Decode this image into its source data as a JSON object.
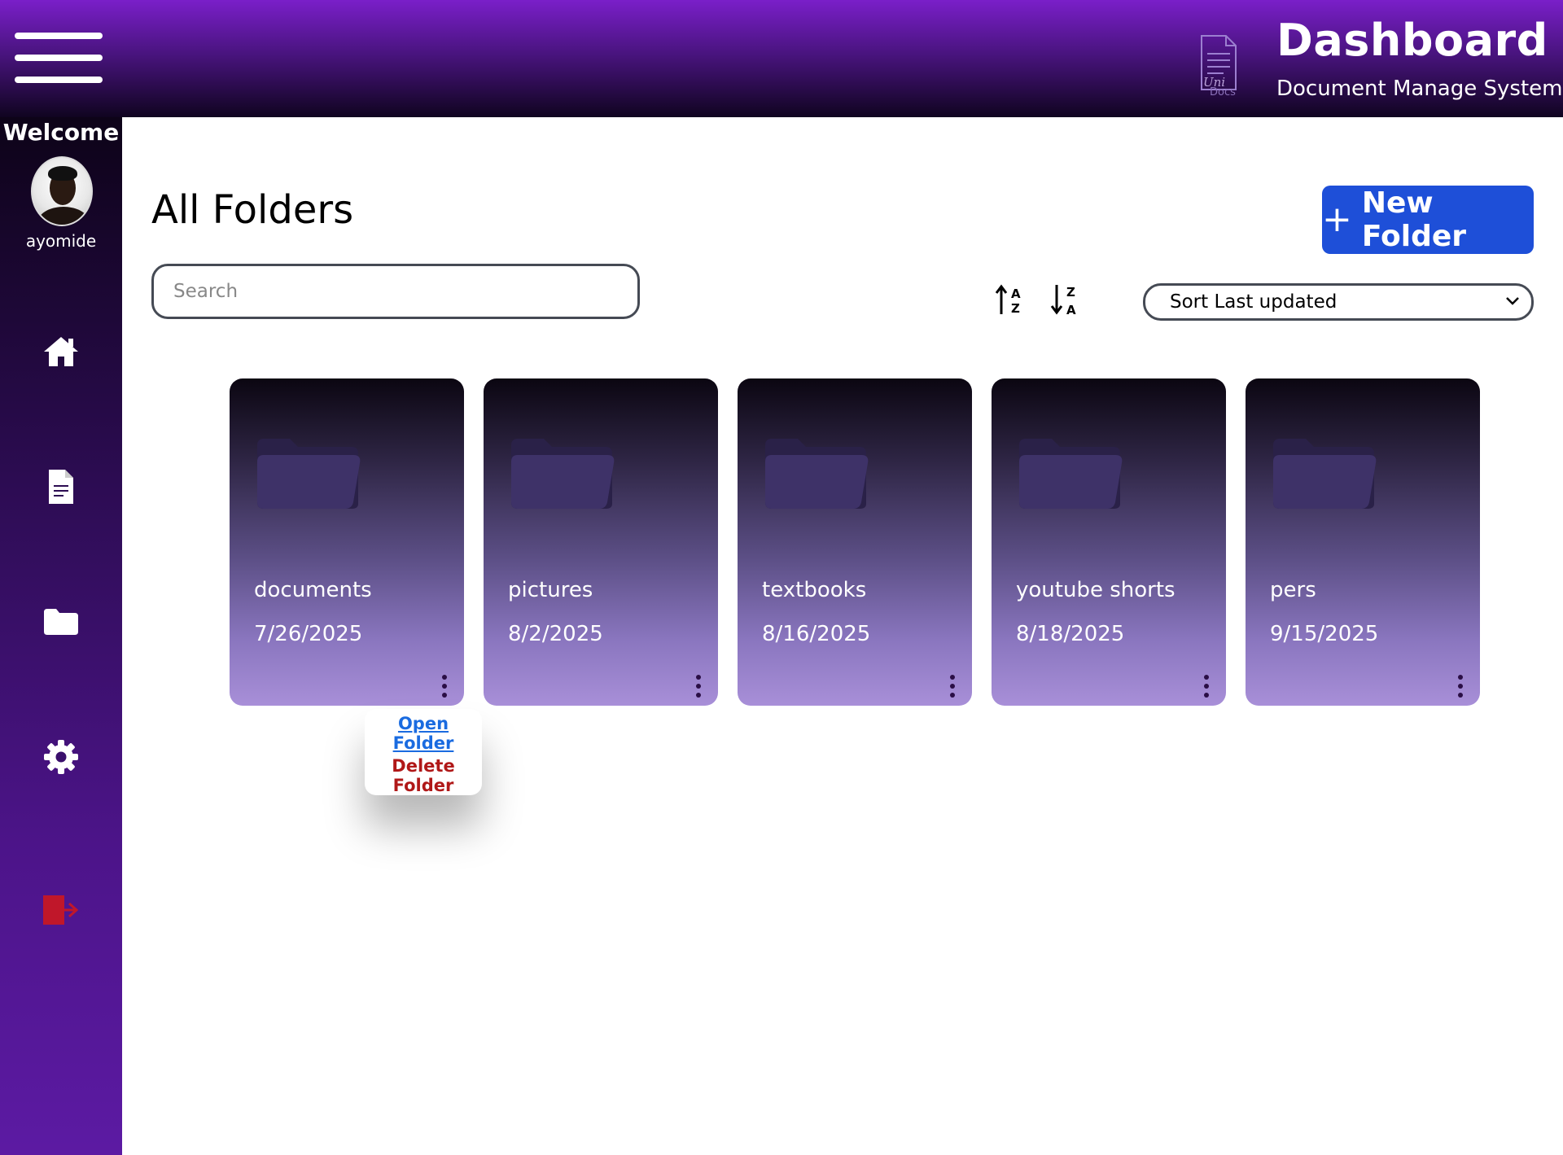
{
  "header": {
    "title": "Dashboard",
    "subtitle": "Document Manage System",
    "logo_line1": "Uni",
    "logo_line2": "Docs",
    "menu_icon": "hamburger-icon"
  },
  "sidebar": {
    "welcome": "Welcome",
    "username": "ayomide",
    "nav": [
      {
        "icon": "home-icon"
      },
      {
        "icon": "document-icon"
      },
      {
        "icon": "folder-icon"
      },
      {
        "icon": "gear-icon"
      },
      {
        "icon": "logout-icon",
        "color": "#c0172a"
      }
    ]
  },
  "main": {
    "title": "All Folders",
    "new_folder_label": "New Folder",
    "search_placeholder": "Search",
    "sort_select": "Sort Last updated",
    "sort_icons": [
      "sort-a-z-icon",
      "sort-z-a-icon"
    ]
  },
  "folders": [
    {
      "name": "documents",
      "date": "7/26/2025"
    },
    {
      "name": "pictures",
      "date": "8/2/2025"
    },
    {
      "name": "textbooks",
      "date": "8/16/2025"
    },
    {
      "name": "youtube shorts",
      "date": "8/18/2025"
    },
    {
      "name": "pers",
      "date": "9/15/2025"
    }
  ],
  "context_menu": {
    "open": "Open Folder",
    "delete": "Delete Folder"
  },
  "colors": {
    "accent": "#1e4fd8",
    "header_top": "#7a1fc9",
    "sidebar_bottom": "#5c1aa3",
    "delete": "#b01818",
    "link": "#1a6be0"
  }
}
